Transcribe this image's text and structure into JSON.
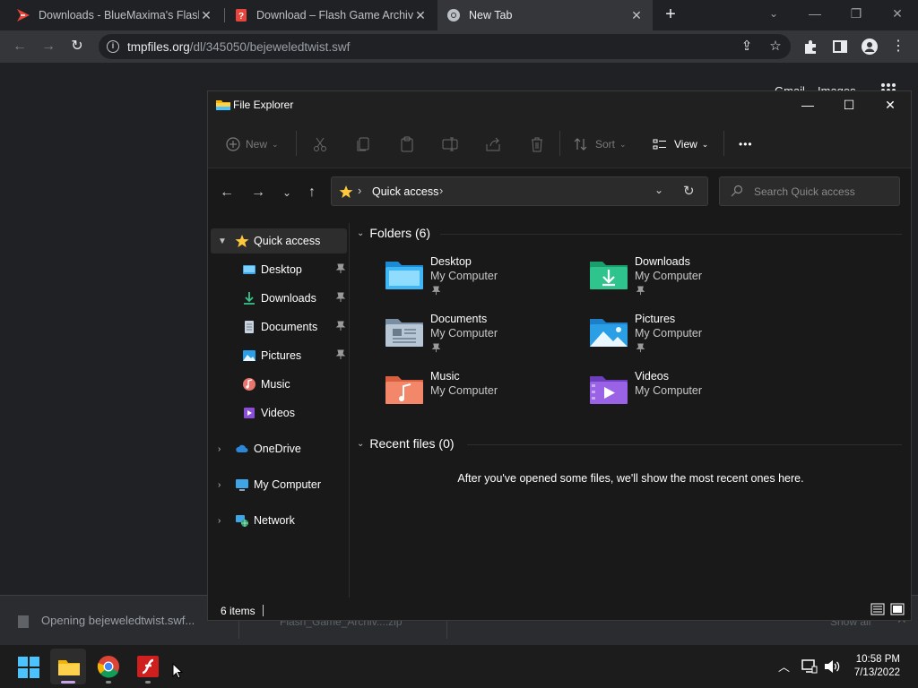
{
  "browser": {
    "tabs": [
      {
        "title": "Downloads - BlueMaxima's Flash"
      },
      {
        "title": "Download – Flash Game Archive"
      },
      {
        "title": "New Tab"
      }
    ],
    "url_host": "tmpfiles.org",
    "url_path": "/dl/345050/bejeweledtwist.swf",
    "page_links": {
      "gmail": "Gmail",
      "images": "Images"
    },
    "window_controls": {
      "minimize": "—",
      "restore": "❐",
      "close": "✕"
    }
  },
  "download_shelf": {
    "item1": "Opening bejeweledtwist.swf...",
    "item2": "Flash_Game_Archiv....zip",
    "show_all": "Show all"
  },
  "explorer": {
    "title": "File Explorer",
    "commands": {
      "new": "New",
      "sort": "Sort",
      "view": "View",
      "more": "•••"
    },
    "address": {
      "location": "Quick access"
    },
    "search_placeholder": "Search Quick access",
    "sidebar": {
      "quick_access": "Quick access",
      "items": [
        {
          "label": "Desktop"
        },
        {
          "label": "Downloads"
        },
        {
          "label": "Documents"
        },
        {
          "label": "Pictures"
        },
        {
          "label": "Music"
        },
        {
          "label": "Videos"
        }
      ],
      "onedrive": "OneDrive",
      "my_computer": "My Computer",
      "network": "Network"
    },
    "folders_header": "Folders (6)",
    "folders": [
      {
        "name": "Desktop",
        "location": "My Computer"
      },
      {
        "name": "Downloads",
        "location": "My Computer"
      },
      {
        "name": "Documents",
        "location": "My Computer"
      },
      {
        "name": "Pictures",
        "location": "My Computer"
      },
      {
        "name": "Music",
        "location": "My Computer"
      },
      {
        "name": "Videos",
        "location": "My Computer"
      }
    ],
    "recent_header": "Recent files (0)",
    "recent_empty": "After you've opened some files, we'll show the most recent ones here.",
    "status": "6 items"
  },
  "taskbar": {
    "time": "10:58 PM",
    "date": "7/13/2022"
  }
}
